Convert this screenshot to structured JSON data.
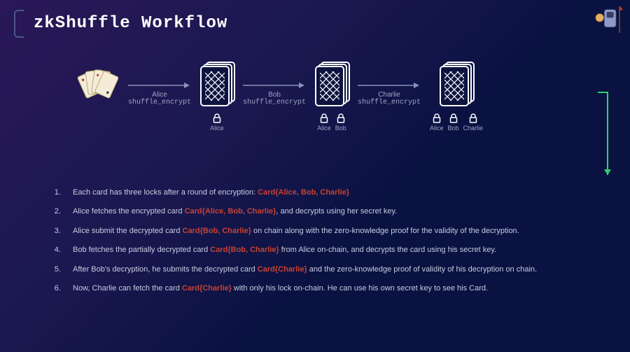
{
  "title": "zkShuffle Workflow",
  "participants": [
    "Alice",
    "Bob",
    "Charlie"
  ],
  "fn": "shuffle_encrypt",
  "steps": [
    {
      "pre": "Each card has three locks after a round of encryption: ",
      "hl": "Card{Alice, Bob, Charlie}",
      "post": ""
    },
    {
      "pre": "Alice fetches the encrypted card ",
      "hl": "Card{Alice, Bob, Charlie}",
      "post": ", and decrypts using her secret key."
    },
    {
      "pre": "Alice submit the decrypted card ",
      "hl": "Card{Bob, Charlie}",
      "post": "  on chain along with the zero-knowledge proof for the validity of the decryption."
    },
    {
      "pre": "Bob fetches the partially decrypted card ",
      "hl": "Card{Bob, Charlie}",
      "post": " from Alice on-chain, and decrypts the card using his secret key."
    },
    {
      "pre": "After Bob's decryption, he submits the decrypted card ",
      "hl": "Card{Charlie}",
      "post": " and the zero-knowledge proof of validity of his decryption on chain."
    },
    {
      "pre": "Now, Charlie can fetch the card ",
      "hl": "Card{Charlie}",
      "post": "  with only his lock on-chain. He can use his own secret key to see his Card."
    }
  ]
}
